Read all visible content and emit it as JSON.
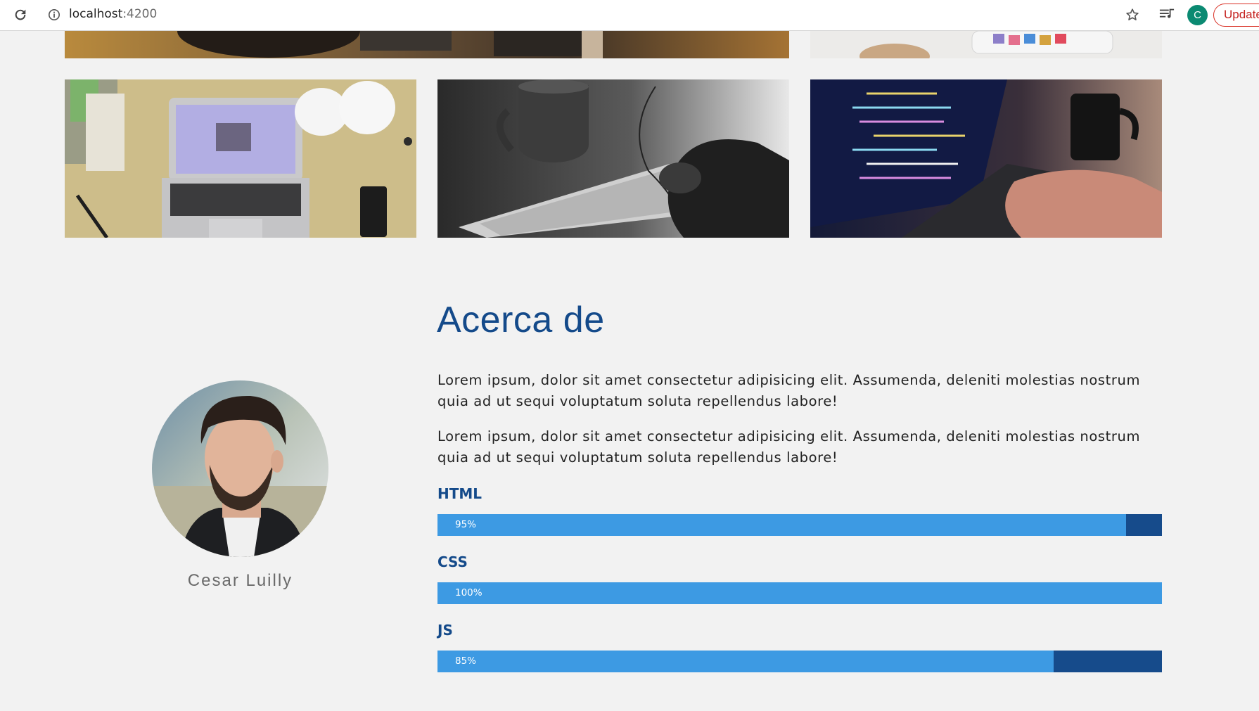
{
  "browser": {
    "url_host": "localhost",
    "url_port": ":4200",
    "avatar_letter": "C",
    "update_label": "Update"
  },
  "about": {
    "title": "Acerca de",
    "paragraphs": [
      "Lorem ipsum, dolor sit amet consectetur adipisicing elit. Assumenda, deleniti molestias nostrum quia ad ut sequi voluptatum soluta repellendus labore!",
      "Lorem ipsum, dolor sit amet consectetur adipisicing elit. Assumenda, deleniti molestias nostrum quia ad ut sequi voluptatum soluta repellendus labore!"
    ],
    "profile_name": "Cesar Luilly"
  },
  "skills": [
    {
      "name": "HTML",
      "percent_label": "95%",
      "level": 0.95
    },
    {
      "name": "CSS",
      "percent_label": "100%",
      "level": 1.0
    },
    {
      "name": "JS",
      "percent_label": "85%",
      "level": 0.85
    }
  ],
  "colors": {
    "heading": "#144a8a",
    "bar_fill": "#3d9ae3",
    "bar_track": "#164b8b",
    "background": "#f2f2f2"
  }
}
